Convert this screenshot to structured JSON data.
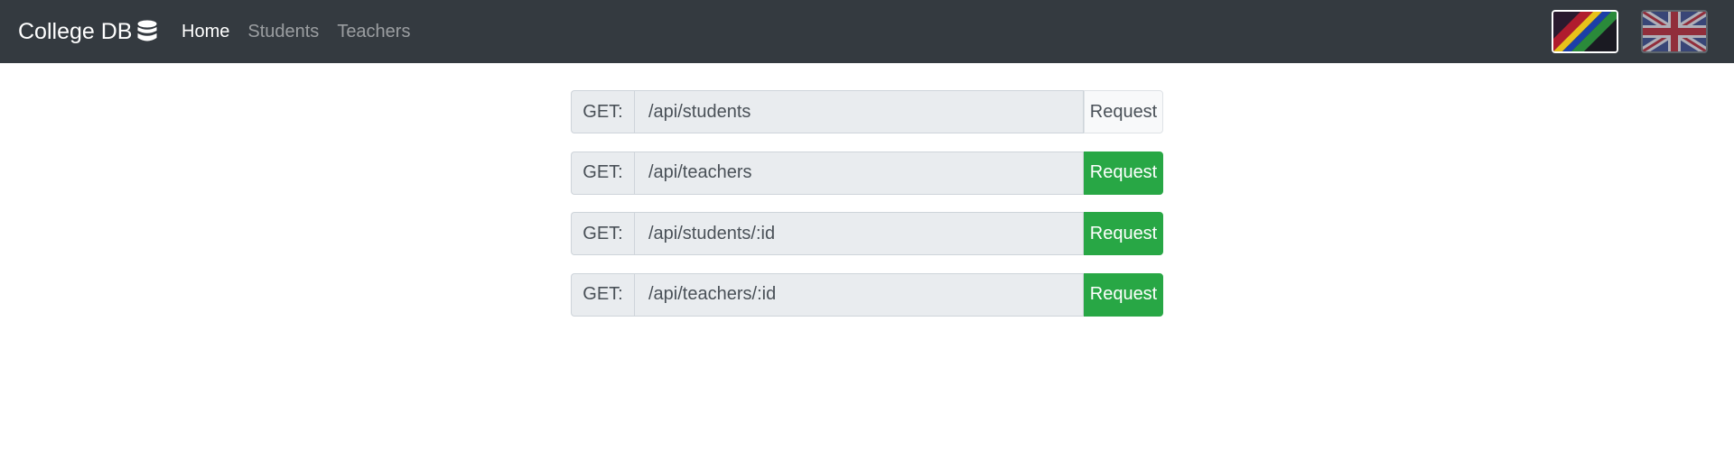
{
  "navbar": {
    "brand": "College DB",
    "brand_icon": "database-icon",
    "links": [
      {
        "label": "Home",
        "active": true
      },
      {
        "label": "Students",
        "active": false
      },
      {
        "label": "Teachers",
        "active": false
      }
    ],
    "flags": [
      {
        "name": "colorful-flag-icon",
        "selected": true
      },
      {
        "name": "uk-flag-icon",
        "selected": false
      }
    ]
  },
  "endpoints": [
    {
      "method": "GET:",
      "path": "/api/students",
      "button": "Request",
      "button_style": "light"
    },
    {
      "method": "GET:",
      "path": "/api/teachers",
      "button": "Request",
      "button_style": "success"
    },
    {
      "method": "GET:",
      "path": "/api/students/:id",
      "button": "Request",
      "button_style": "success"
    },
    {
      "method": "GET:",
      "path": "/api/teachers/:id",
      "button": "Request",
      "button_style": "success"
    }
  ],
  "colors": {
    "navbar_bg": "#343a40",
    "success": "#28a745",
    "input_bg": "#e9ecef"
  }
}
